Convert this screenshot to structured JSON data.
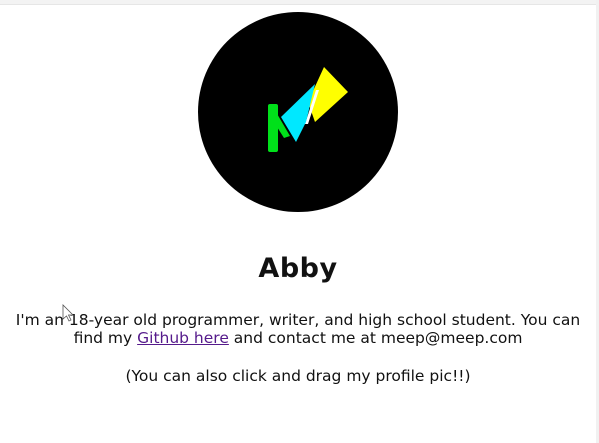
{
  "profile": {
    "name": "Abby",
    "bio_intro": "I'm an 18-year old programmer, writer, and high school student. You can find my ",
    "github_link_text": "Github here",
    "bio_outro": " and contact me at meep@meep.com",
    "hint": "(You can also click and drag my profile pic!!)"
  },
  "avatar": {
    "background": "#000000",
    "colors": {
      "green": "#00e01a",
      "cyan": "#00e8ff",
      "yellow": "#ffff00",
      "white": "#ffffff"
    },
    "icon": "profile-logo-icon"
  },
  "links": {
    "visited_color": "#551a8b"
  }
}
